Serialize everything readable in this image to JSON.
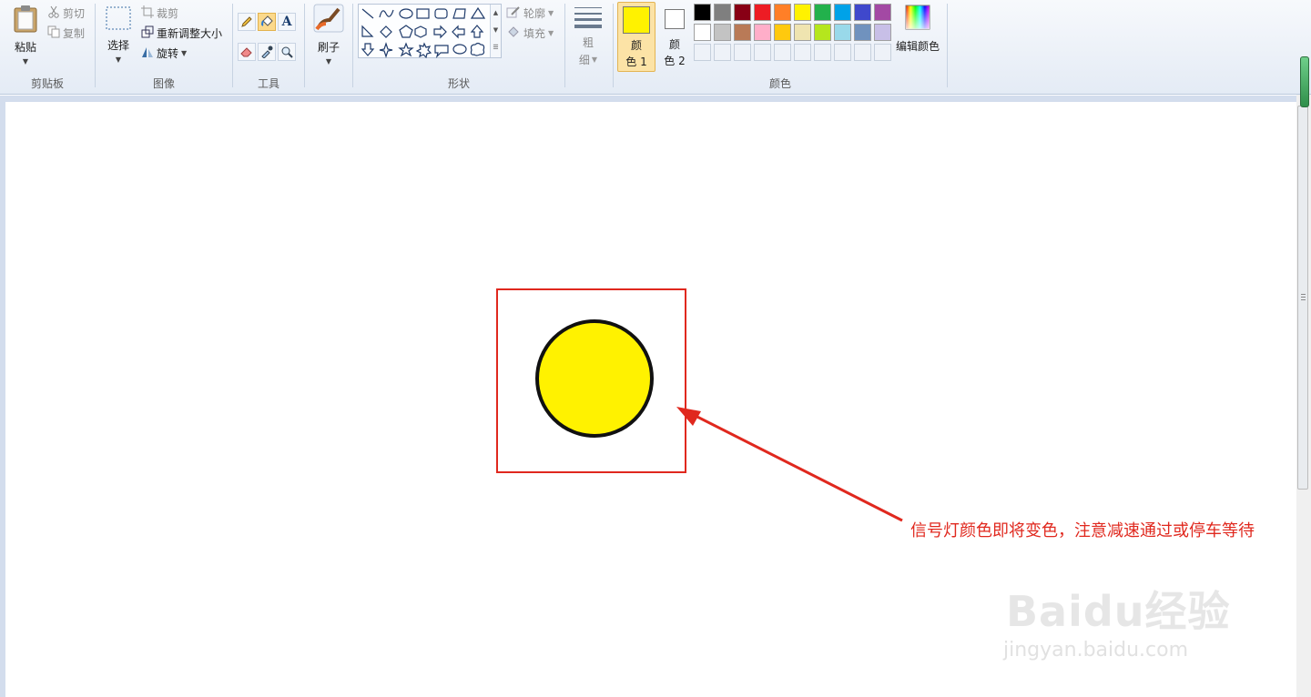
{
  "ribbon": {
    "clipboard": {
      "paste_label": "粘贴",
      "cut_label": "剪切",
      "copy_label": "复制",
      "group_label": "剪贴板"
    },
    "image": {
      "select_label": "选择",
      "crop_label": "裁剪",
      "resize_label": "重新调整大小",
      "rotate_label": "旋转",
      "group_label": "图像"
    },
    "tools": {
      "group_label": "工具",
      "text_tool_glyph": "A"
    },
    "brushes": {
      "label": "刷子"
    },
    "shapes": {
      "outline_label": "轮廓",
      "fill_label": "填充",
      "group_label": "形状"
    },
    "size": {
      "label_line1": "粗",
      "label_line2": "细"
    },
    "colors": {
      "color1_line1": "颜",
      "color1_line2": "色 1",
      "color2_line1": "颜",
      "color2_line2": "色 2",
      "color1_value": "#FFF200",
      "color2_value": "#FFFFFF",
      "edit_colors_label": "编辑颜色",
      "group_label": "颜色",
      "palette_row1": [
        "#000000",
        "#7F7F7F",
        "#880015",
        "#ED1C24",
        "#FF7F27",
        "#FFF200",
        "#22B14C",
        "#00A2E8",
        "#3F48CC",
        "#A349A4"
      ],
      "palette_row2": [
        "#FFFFFF",
        "#C3C3C3",
        "#B97A57",
        "#FFAEC9",
        "#FFC90E",
        "#EFE4B0",
        "#B5E61D",
        "#99D9EA",
        "#7092BE",
        "#C8BFE7"
      ]
    }
  },
  "canvas": {
    "annotation_text": "信号灯颜色即将变色，注意减速通过或停车等待",
    "circle_fill": "#FFF200",
    "frame_color": "#E0281E"
  },
  "watermark": {
    "line1": "Baidu经验",
    "line2": "jingyan.baidu.com"
  }
}
